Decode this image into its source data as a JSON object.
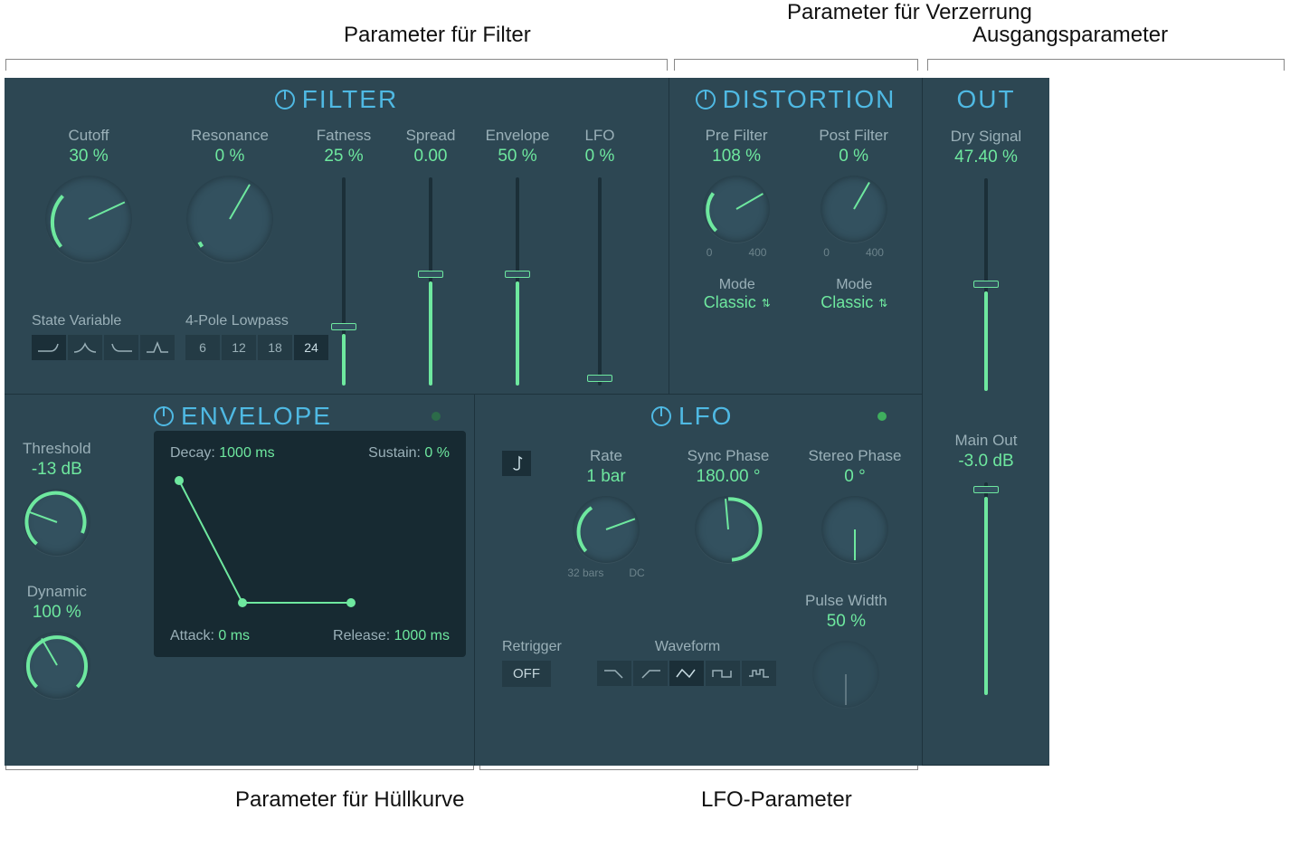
{
  "annotations": {
    "filter": "Parameter für Filter",
    "distortion": "Parameter für Verzerrung",
    "output": "Ausgangsparameter",
    "envelope": "Parameter für Hüllkurve",
    "lfo": "LFO-Parameter"
  },
  "filter": {
    "title": "FILTER",
    "cutoff": {
      "label": "Cutoff",
      "value": "30 %"
    },
    "resonance": {
      "label": "Resonance",
      "value": "0 %"
    },
    "fatness": {
      "label": "Fatness",
      "value": "25 %"
    },
    "spread": {
      "label": "Spread",
      "value": "0.00"
    },
    "envelope": {
      "label": "Envelope",
      "value": "50 %"
    },
    "lfo": {
      "label": "LFO",
      "value": "0 %"
    },
    "state_label": "State Variable",
    "pole_label": "4-Pole Lowpass",
    "poles": [
      "6",
      "12",
      "18",
      "24"
    ]
  },
  "distortion": {
    "title": "DISTORTION",
    "pre": {
      "label": "Pre Filter",
      "value": "108 %",
      "range_min": "0",
      "range_max": "400"
    },
    "post": {
      "label": "Post Filter",
      "value": "0 %",
      "range_min": "0",
      "range_max": "400"
    },
    "mode_label": "Mode",
    "mode_value": "Classic"
  },
  "out": {
    "title": "OUT",
    "dry": {
      "label": "Dry Signal",
      "value": "47.40 %"
    },
    "main": {
      "label": "Main Out",
      "value": "-3.0 dB"
    }
  },
  "envelope": {
    "title": "ENVELOPE",
    "threshold": {
      "label": "Threshold",
      "value": "-13 dB"
    },
    "dynamic": {
      "label": "Dynamic",
      "value": "100 %"
    },
    "decay_label": "Decay:",
    "decay_value": "1000 ms",
    "sustain_label": "Sustain:",
    "sustain_value": "0 %",
    "attack_label": "Attack:",
    "attack_value": "0 ms",
    "release_label": "Release:",
    "release_value": "1000 ms"
  },
  "lfo": {
    "title": "LFO",
    "rate": {
      "label": "Rate",
      "value": "1 bar",
      "range_min": "32 bars",
      "range_max": "DC"
    },
    "sync": {
      "label": "Sync Phase",
      "value": "180.00 °"
    },
    "stereo": {
      "label": "Stereo Phase",
      "value": "0 °"
    },
    "pulse": {
      "label": "Pulse Width",
      "value": "50 %"
    },
    "retrigger_label": "Retrigger",
    "retrigger_value": "OFF",
    "waveform_label": "Waveform"
  }
}
